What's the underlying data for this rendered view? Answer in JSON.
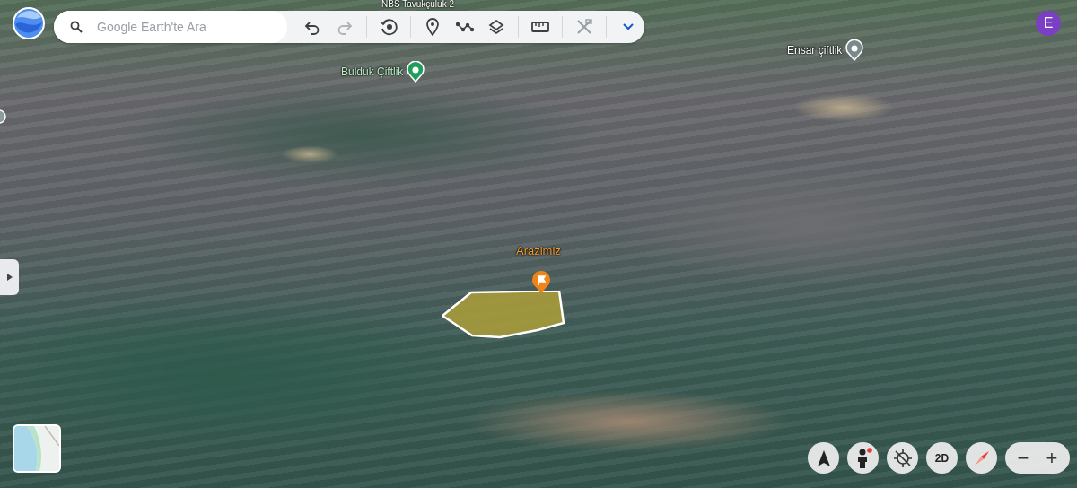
{
  "search": {
    "placeholder": "Google Earth'te Ara"
  },
  "account": {
    "initial": "E"
  },
  "map_labels": [
    {
      "kind": "plain",
      "text": "NBS Tavukçuluk 2"
    },
    {
      "kind": "park",
      "text": "Bulduk Çiftlik"
    },
    {
      "kind": "place",
      "text": "Ensar çiftlik"
    },
    {
      "kind": "flag",
      "text": "Arazimiz"
    }
  ],
  "view_toggle": {
    "label": "2D"
  },
  "zoom": {
    "out": "−",
    "in": "+"
  }
}
